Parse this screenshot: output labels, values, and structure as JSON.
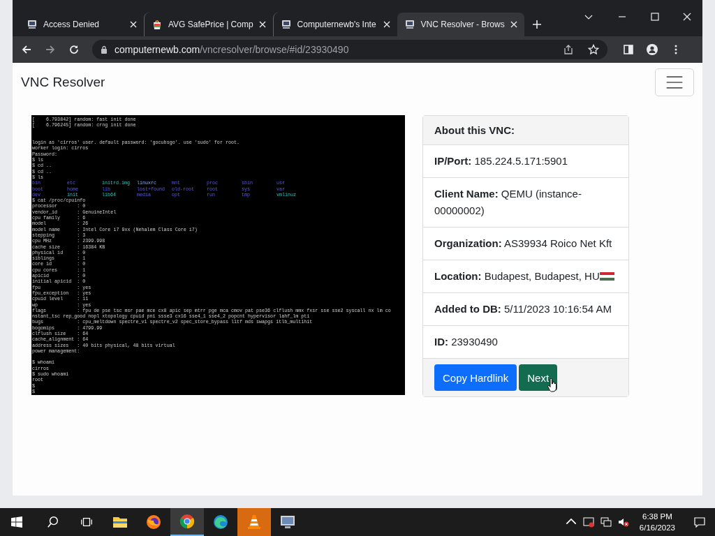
{
  "browser": {
    "tabs": [
      {
        "title": "Access Denied",
        "kind": "site",
        "selected": false
      },
      {
        "title": "AVG SafePrice | Comp",
        "kind": "shop",
        "selected": false
      },
      {
        "title": "Computernewb's Inte",
        "kind": "site",
        "selected": false
      },
      {
        "title": "VNC Resolver - Brows",
        "kind": "site",
        "selected": true
      }
    ],
    "address": {
      "host": "computernewb.com",
      "path": "/vncresolver/browse/#id/23930490"
    }
  },
  "page": {
    "brand": "VNC Resolver",
    "screen_lines": [
      {
        "kind": "text",
        "text": "[    6.793842] random: fast init done"
      },
      {
        "kind": "text",
        "text": "[    6.796245] random: crng init done"
      },
      {
        "kind": "blank"
      },
      {
        "kind": "blank"
      },
      {
        "kind": "text",
        "text": "login as 'cirros' user. default password: 'gocubsgo'. use 'sudo' for root."
      },
      {
        "kind": "text",
        "text": "worker login: cirros"
      },
      {
        "kind": "text",
        "text": "Password:"
      },
      {
        "kind": "text",
        "text": "$ ls"
      },
      {
        "kind": "text",
        "text": "$ cd .."
      },
      {
        "kind": "text",
        "text": "$ cd .."
      },
      {
        "kind": "text",
        "text": "$ ls"
      },
      {
        "kind": "ls",
        "entries": [
          {
            "name": "bin",
            "kind": "dir"
          },
          {
            "name": "etc",
            "kind": "dir"
          },
          {
            "name": "initrd.img",
            "kind": "file"
          },
          {
            "name": "linuxrc",
            "kind": "link"
          },
          {
            "name": "mnt",
            "kind": "dir"
          },
          {
            "name": "proc",
            "kind": "dir"
          },
          {
            "name": "sbin",
            "kind": "dir"
          },
          {
            "name": "usr",
            "kind": "dir"
          }
        ]
      },
      {
        "kind": "ls",
        "entries": [
          {
            "name": "boot",
            "kind": "dir"
          },
          {
            "name": "home",
            "kind": "dir"
          },
          {
            "name": "lib",
            "kind": "dir"
          },
          {
            "name": "lost+found",
            "kind": "dir"
          },
          {
            "name": "old-root",
            "kind": "dir"
          },
          {
            "name": "root",
            "kind": "dir"
          },
          {
            "name": "sys",
            "kind": "dir"
          },
          {
            "name": "var",
            "kind": "dir"
          }
        ]
      },
      {
        "kind": "ls",
        "entries": [
          {
            "name": "dev",
            "kind": "dir"
          },
          {
            "name": "init",
            "kind": "file"
          },
          {
            "name": "lib64",
            "kind": "file"
          },
          {
            "name": "media",
            "kind": "dir"
          },
          {
            "name": "opt",
            "kind": "dir"
          },
          {
            "name": "run",
            "kind": "dir"
          },
          {
            "name": "tmp",
            "kind": "dir"
          },
          {
            "name": "vmlinuz",
            "kind": "file"
          }
        ]
      },
      {
        "kind": "text",
        "text": "$ cat /proc/cpuinfo"
      },
      {
        "kind": "text",
        "text": "processor       : 0"
      },
      {
        "kind": "text",
        "text": "vendor_id       : GenuineIntel"
      },
      {
        "kind": "text",
        "text": "cpu family      : 6"
      },
      {
        "kind": "text",
        "text": "model           : 26"
      },
      {
        "kind": "text",
        "text": "model name      : Intel Core i7 9xx (Nehalem Class Core i7)"
      },
      {
        "kind": "text",
        "text": "stepping        : 3"
      },
      {
        "kind": "text",
        "text": "cpu MHz         : 2399.998"
      },
      {
        "kind": "text",
        "text": "cache size      : 16384 KB"
      },
      {
        "kind": "text",
        "text": "physical id     : 0"
      },
      {
        "kind": "text",
        "text": "siblings        : 1"
      },
      {
        "kind": "text",
        "text": "core id         : 0"
      },
      {
        "kind": "text",
        "text": "cpu cores       : 1"
      },
      {
        "kind": "text",
        "text": "apicid          : 0"
      },
      {
        "kind": "text",
        "text": "initial apicid  : 0"
      },
      {
        "kind": "text",
        "text": "fpu             : yes"
      },
      {
        "kind": "text",
        "text": "fpu_exception   : yes"
      },
      {
        "kind": "text",
        "text": "cpuid level     : 11"
      },
      {
        "kind": "text",
        "text": "wp              : yes"
      },
      {
        "kind": "text",
        "text": "flags           : fpu de pse tsc msr pae mce cx8 apic sep mtrr pge mca cmov pat pse36 clflush mmx fxsr sse sse2 syscall nx lm co"
      },
      {
        "kind": "text",
        "text": "nstant_tsc rep_good nopl xtopology cpuid pni ssse3 cx16 sse4_1 sse4_2 popcnt hypervisor lahf_lm pti"
      },
      {
        "kind": "text",
        "text": "bugs            : cpu_meltdown spectre_v1 spectre_v2 spec_store_bypass l1tf mds swapgs itlb_multihit"
      },
      {
        "kind": "text",
        "text": "bogomips        : 4799.99"
      },
      {
        "kind": "text",
        "text": "clflush size    : 64"
      },
      {
        "kind": "text",
        "text": "cache_alignment : 64"
      },
      {
        "kind": "text",
        "text": "address sizes   : 40 bits physical, 48 bits virtual"
      },
      {
        "kind": "text",
        "text": "power management:"
      },
      {
        "kind": "blank"
      },
      {
        "kind": "text",
        "text": "$ whoami"
      },
      {
        "kind": "text",
        "text": "cirros"
      },
      {
        "kind": "text",
        "text": "$ sudo whoami"
      },
      {
        "kind": "text",
        "text": "root"
      },
      {
        "kind": "text",
        "text": "$"
      },
      {
        "kind": "text",
        "text": "$"
      }
    ],
    "card": {
      "title": "About this VNC:",
      "fields": [
        {
          "label": "IP/Port:",
          "value": "185.224.5.171:5901",
          "flag": false
        },
        {
          "label": "Client Name:",
          "value": "QEMU (instance-00000002)",
          "flag": false
        },
        {
          "label": "Organization:",
          "value": "AS39934 Roico Net Kft",
          "flag": false
        },
        {
          "label": "Location:",
          "value": "Budapest, Budapest, HU",
          "flag": true
        },
        {
          "label": "Added to DB:",
          "value": "5/11/2023 10:16:54 AM",
          "flag": false
        },
        {
          "label": "ID:",
          "value": "23930490",
          "flag": false
        }
      ],
      "buttons": [
        {
          "label": "Copy Hardlink",
          "kind": "primary"
        },
        {
          "label": "Next",
          "kind": "success"
        }
      ]
    }
  },
  "taskbar": {
    "apps": [
      {
        "kind": "explorer",
        "selected": false,
        "flashing": false
      },
      {
        "kind": "firefox",
        "selected": false,
        "flashing": false
      },
      {
        "kind": "chrome",
        "selected": true,
        "flashing": false
      },
      {
        "kind": "edge",
        "selected": false,
        "flashing": false
      },
      {
        "kind": "cone",
        "selected": false,
        "flashing": true
      },
      {
        "kind": "monitor",
        "selected": false,
        "flashing": false
      }
    ],
    "time": "6:38 PM",
    "date": "6/16/2023"
  }
}
